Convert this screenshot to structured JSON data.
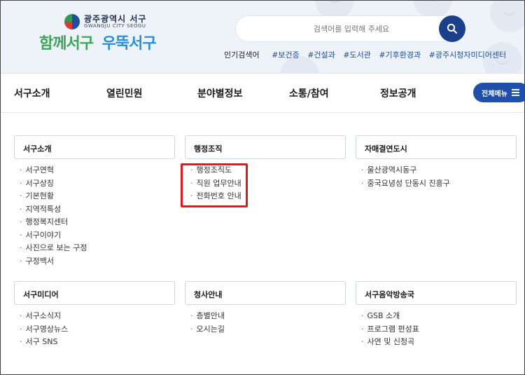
{
  "header": {
    "city_name": "광주광역시 서구",
    "city_name_en": "GWANGJU CITY SEOGU",
    "slogan_part1": "함께서구",
    "slogan_part2": "우뚝서구",
    "search_placeholder": "검색어를 입력해 주세요",
    "popular_title": "인기검색어",
    "popular_tags": [
      "#보건증",
      "#건설과",
      "#도서관",
      "#기후환경과",
      "#광주시청자미디어센터"
    ]
  },
  "nav": {
    "items": [
      "서구소개",
      "열린민원",
      "분야별정보",
      "소통/참여",
      "정보공개"
    ],
    "all_menu_label": "전체메뉴"
  },
  "sections": [
    {
      "title": "서구소개",
      "items": [
        "서구연혁",
        "서구상징",
        "기본현황",
        "지역적특성",
        "행정복지센터",
        "서구이야기",
        "사진으로 보는 구정",
        "구정백서"
      ]
    },
    {
      "title": "행정조직",
      "items": [
        "행정조직도",
        "직원 업무안내",
        "전화번호 안내"
      ]
    },
    {
      "title": "자매결연도시",
      "items": [
        "울산광역시동구",
        "중국요녕성 단동시 진흥구"
      ]
    },
    {
      "title": "서구미디어",
      "items": [
        "서구소식지",
        "서구영상뉴스",
        "서구 SNS"
      ]
    },
    {
      "title": "청사안내",
      "items": [
        "층별안내",
        "오시는길"
      ]
    },
    {
      "title": "서구음악방송국",
      "items": [
        "GSB 소개",
        "프로그램 편성표",
        "사연 및 신청곡"
      ]
    }
  ],
  "colors": {
    "accent": "#1f4fa8",
    "highlight": "#e01919",
    "header_bg": "#eef3f9"
  },
  "icons": {
    "search": "search-icon",
    "menu": "hamburger-icon"
  }
}
